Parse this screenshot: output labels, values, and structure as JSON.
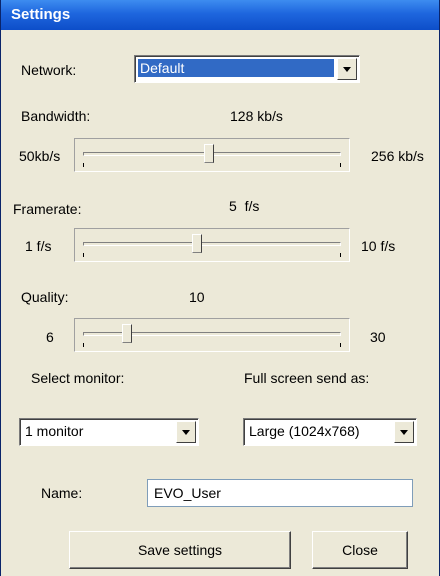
{
  "window": {
    "title": "Settings"
  },
  "network": {
    "label": "Network:",
    "value": "Default"
  },
  "bandwidth": {
    "label": "Bandwidth:",
    "current": "128 kb/s",
    "min": "50kb/s",
    "max": "256 kb/s",
    "position": 0.49
  },
  "framerate": {
    "label": "Framerate:",
    "current": "5  f/s",
    "min": "1 f/s",
    "max": "10 f/s",
    "position": 0.44
  },
  "quality": {
    "label": "Quality:",
    "current": "10",
    "min": "6",
    "max": "30",
    "position": 0.17
  },
  "monitor": {
    "label": "Select monitor:",
    "value": "1 monitor"
  },
  "fullscreen": {
    "label": "Full screen send as:",
    "value": "Large (1024x768)"
  },
  "name": {
    "label": "Name:",
    "value": "EVO_User"
  },
  "buttons": {
    "save": "Save settings",
    "close": "Close"
  }
}
